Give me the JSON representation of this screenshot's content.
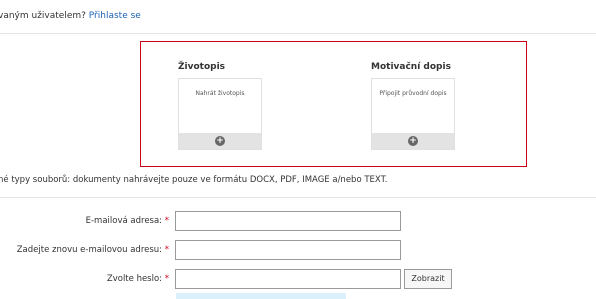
{
  "login": {
    "prefix": "vaným uživatelem? ",
    "link": "Přihlaste se"
  },
  "upload": {
    "cv": {
      "title": "Životopis",
      "card_label": "Nahrát životopis",
      "button_icon": "plus-circle-icon"
    },
    "cover": {
      "title": "Motivační dopis",
      "card_label": "Připojit průvodní dopis",
      "button_icon": "plus-circle-icon"
    },
    "border_color": "#d0021b"
  },
  "filetypes_note": "né typy souborů: dokumenty nahrávejte pouze ve formátu DOCX, PDF, IMAGE a/nebo TEXT.",
  "form": {
    "required_marker": "*",
    "email": {
      "label": "E-mailová adresa:",
      "value": ""
    },
    "email_confirm": {
      "label": "Zadejte znovu e-mailovou adresu:",
      "value": ""
    },
    "password": {
      "label": "Zvolte heslo:",
      "value": "",
      "show_label": "Zobrazit"
    }
  }
}
